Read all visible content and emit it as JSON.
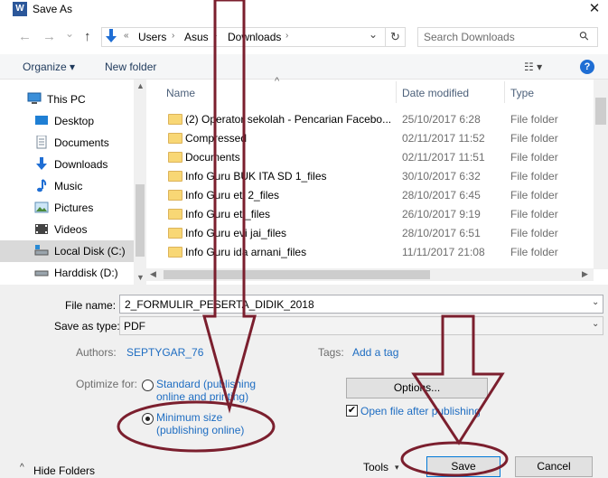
{
  "window": {
    "title": "Save As",
    "app_icon_letter": "W",
    "close_glyph": "✕"
  },
  "nav": {
    "back": "←",
    "forward": "→",
    "recent": "⌄",
    "up": "↑",
    "crumbs": [
      "«",
      "Users",
      "Asus",
      "Downloads"
    ],
    "refresh": "↻",
    "search_placeholder": "Search Downloads",
    "search_glyph": "⚲"
  },
  "toolbar": {
    "organize": "Organize ▾",
    "new_folder": "New folder",
    "view_glyph": "☷ ▾",
    "help": "?"
  },
  "sidebar": {
    "items": [
      {
        "label": "This PC",
        "icon": "pc-icon"
      },
      {
        "label": "Desktop",
        "icon": "desktop-icon"
      },
      {
        "label": "Documents",
        "icon": "documents-icon"
      },
      {
        "label": "Downloads",
        "icon": "downloads-icon"
      },
      {
        "label": "Music",
        "icon": "music-icon"
      },
      {
        "label": "Pictures",
        "icon": "pictures-icon"
      },
      {
        "label": "Videos",
        "icon": "videos-icon"
      },
      {
        "label": "Local Disk (C:)",
        "icon": "drive-icon"
      },
      {
        "label": "Harddisk (D:)",
        "icon": "drive-icon"
      }
    ]
  },
  "files": {
    "columns": {
      "name": "Name",
      "date": "Date modified",
      "type": "Type",
      "sort_glyph": "^"
    },
    "rows": [
      {
        "name": "(2) Operator sekolah - Pencarian Facebo...",
        "date": "25/10/2017 6:28",
        "type": "File folder"
      },
      {
        "name": "Compressed",
        "date": "02/11/2017 11:52",
        "type": "File folder"
      },
      {
        "name": "Documents",
        "date": "02/11/2017 11:51",
        "type": "File folder"
      },
      {
        "name": "Info Guru BUK ITA SD 1_files",
        "date": "30/10/2017 6:32",
        "type": "File folder"
      },
      {
        "name": "Info Guru eti 2_files",
        "date": "28/10/2017 6:45",
        "type": "File folder"
      },
      {
        "name": "Info Guru eti_files",
        "date": "26/10/2017 9:19",
        "type": "File folder"
      },
      {
        "name": "Info Guru evi jai_files",
        "date": "28/10/2017 6:51",
        "type": "File folder"
      },
      {
        "name": "Info Guru ida arnani_files",
        "date": "11/11/2017 21:08",
        "type": "File folder"
      }
    ]
  },
  "form": {
    "file_name_label": "File name:",
    "file_name_value": "2_FORMULIR_PESERTA_DIDIK_2018",
    "save_type_label": "Save as type:",
    "save_type_value": "PDF",
    "authors_label": "Authors:",
    "authors_value": "SEPTYGAR_76",
    "tags_label": "Tags:",
    "tags_value": "Add a tag",
    "optimize_label": "Optimize for:",
    "opt_standard_line1": "Standard (publishing",
    "opt_standard_line2": "online and printing)",
    "opt_min_line1": "Minimum size",
    "opt_min_line2": "(publishing online)",
    "options_button": "Options...",
    "open_after_label": "Open file after publishing",
    "open_after_checked": true,
    "hide_folders": "Hide Folders",
    "tools": "Tools",
    "save": "Save",
    "cancel": "Cancel",
    "dropdown_glyph": "⌄",
    "hide_glyph": "^",
    "tools_glyph": "▾"
  },
  "annotation_color": "#7b1f2e"
}
